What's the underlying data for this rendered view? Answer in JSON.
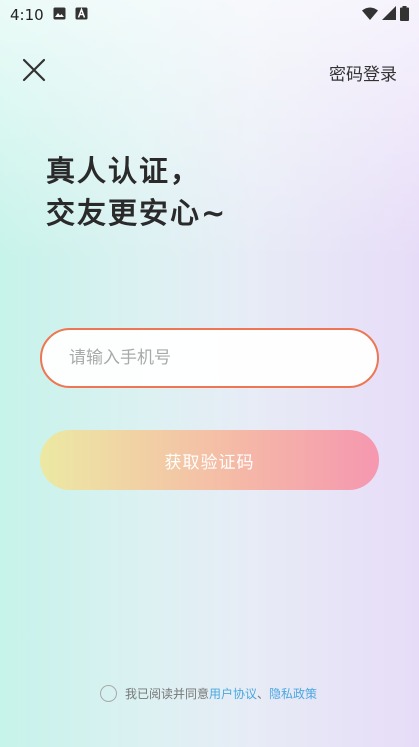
{
  "status_bar": {
    "time": "4:10"
  },
  "header": {
    "password_login_label": "密码登录"
  },
  "headline": {
    "line1": "真人认证，",
    "line2": "交友更安心~"
  },
  "phone_input": {
    "placeholder": "请输入手机号",
    "value": ""
  },
  "get_code_button": {
    "label": "获取验证码"
  },
  "agreement": {
    "prefix": "我已阅读并同意",
    "user_agreement": "用户协议",
    "separator": "、",
    "privacy_policy": "隐私政策"
  },
  "colors": {
    "input_border": "#ee7653",
    "button_gradient_start": "#ece9a3",
    "button_gradient_end": "#f597b0",
    "link": "#4aa8e0"
  },
  "icons": [
    "image-icon",
    "a-icon",
    "wifi-icon",
    "signal-icon",
    "battery-icon",
    "close-icon"
  ]
}
